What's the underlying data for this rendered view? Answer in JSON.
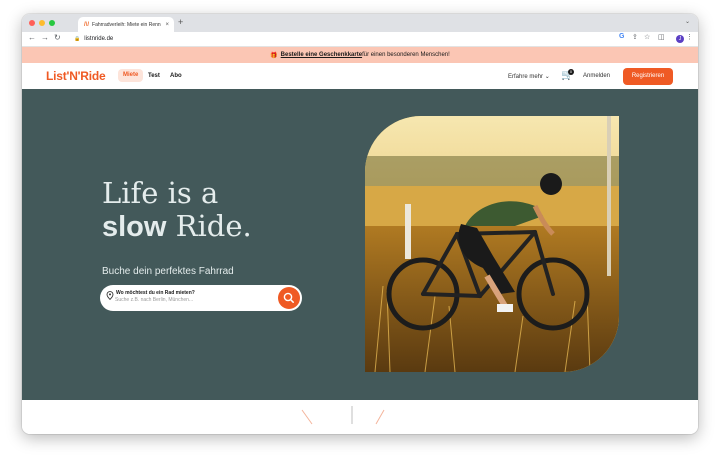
{
  "browser": {
    "tab_title": "Fahrradverleih: Miete ein Renn",
    "tab_close": "×",
    "new_tab": "+",
    "url": "listnride.de"
  },
  "promo": {
    "emoji": "🎁",
    "link_text": "Bestelle eine Geschenkkarte",
    "text": "für einen besonderen Menschen!"
  },
  "nav": {
    "logo": "List'N'Ride",
    "links": [
      "Miete",
      "Test",
      "Abo"
    ],
    "learn_more": "Erfahre mehr",
    "cart_count": "0",
    "login": "Anmelden",
    "register": "Registrieren"
  },
  "hero": {
    "title_line1": "Life is a",
    "title_bold": "slow",
    "title_rest": " Ride.",
    "subtitle": "Buche dein perfektes Fahrrad",
    "search_label": "Wo möchtest du ein Rad mieten?",
    "search_placeholder": "Suche z.B. nach Berlin, München...",
    "search_value": ""
  },
  "colors": {
    "brand_orange": "#ef5a24",
    "hero_bg": "#43595a",
    "promo_bg": "#fbc6b4"
  },
  "icons": [
    "back-icon",
    "forward-icon",
    "reload-icon",
    "lock-icon",
    "google-icon",
    "share-icon",
    "star-icon",
    "sidebar-icon",
    "menu-icon",
    "cart-icon",
    "location-pin-icon",
    "search-icon",
    "chevron-down-icon"
  ]
}
